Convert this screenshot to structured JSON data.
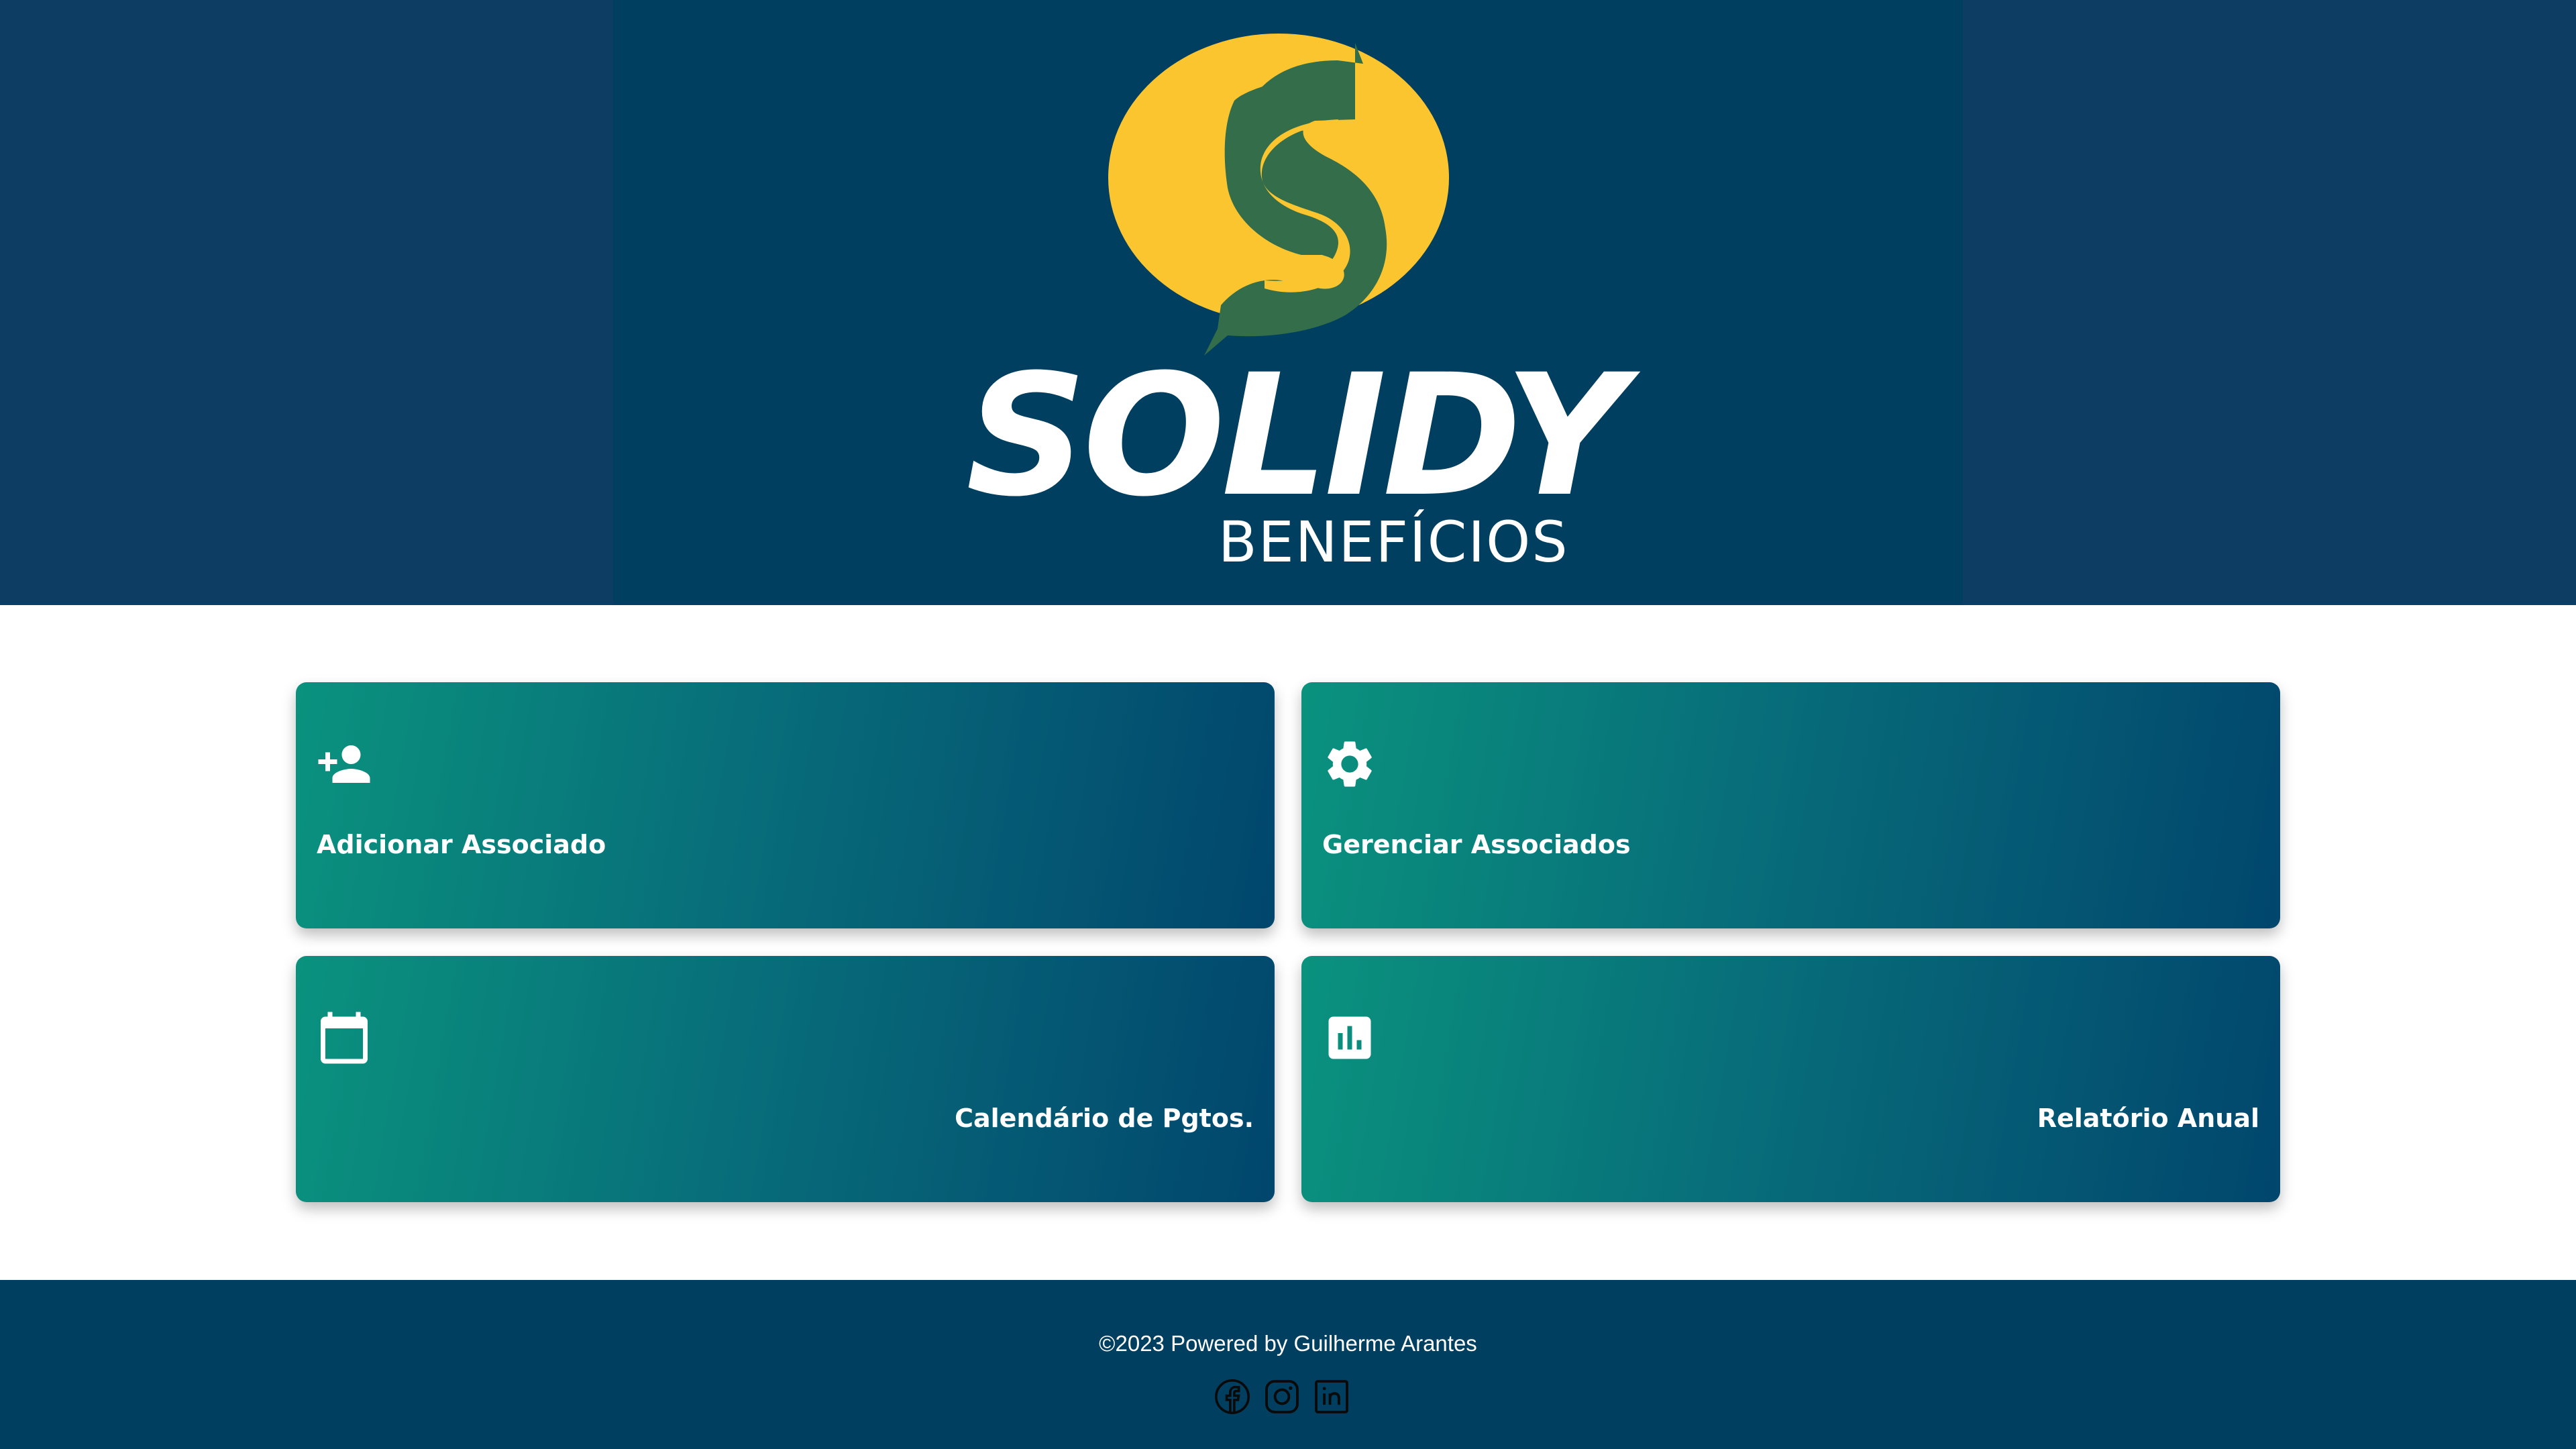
{
  "header": {
    "brand_name": "SOLIDY",
    "brand_sub": "BENEFÍCIOS",
    "colors": {
      "outer": "#0e3d63",
      "inner": "#013f60",
      "logo_yellow": "#fbc530",
      "logo_green": "#336d4a"
    }
  },
  "cards": [
    {
      "label": "Adicionar Associado",
      "icon": "add-user-icon",
      "align": "left"
    },
    {
      "label": "Gerenciar Associados",
      "icon": "gear-icon",
      "align": "left"
    },
    {
      "label": "Calendário de Pgtos.",
      "icon": "calendar-icon",
      "align": "right"
    },
    {
      "label": "Relatório Anual",
      "icon": "bar-chart-icon",
      "align": "right"
    }
  ],
  "card_gradient": {
    "start": "#0a927e",
    "end": "#01466d"
  },
  "footer": {
    "copyright": "©2023 Powered by Guilherme Arantes",
    "social": [
      "facebook-icon",
      "instagram-icon",
      "linkedin-icon"
    ],
    "background": "#013f60"
  }
}
